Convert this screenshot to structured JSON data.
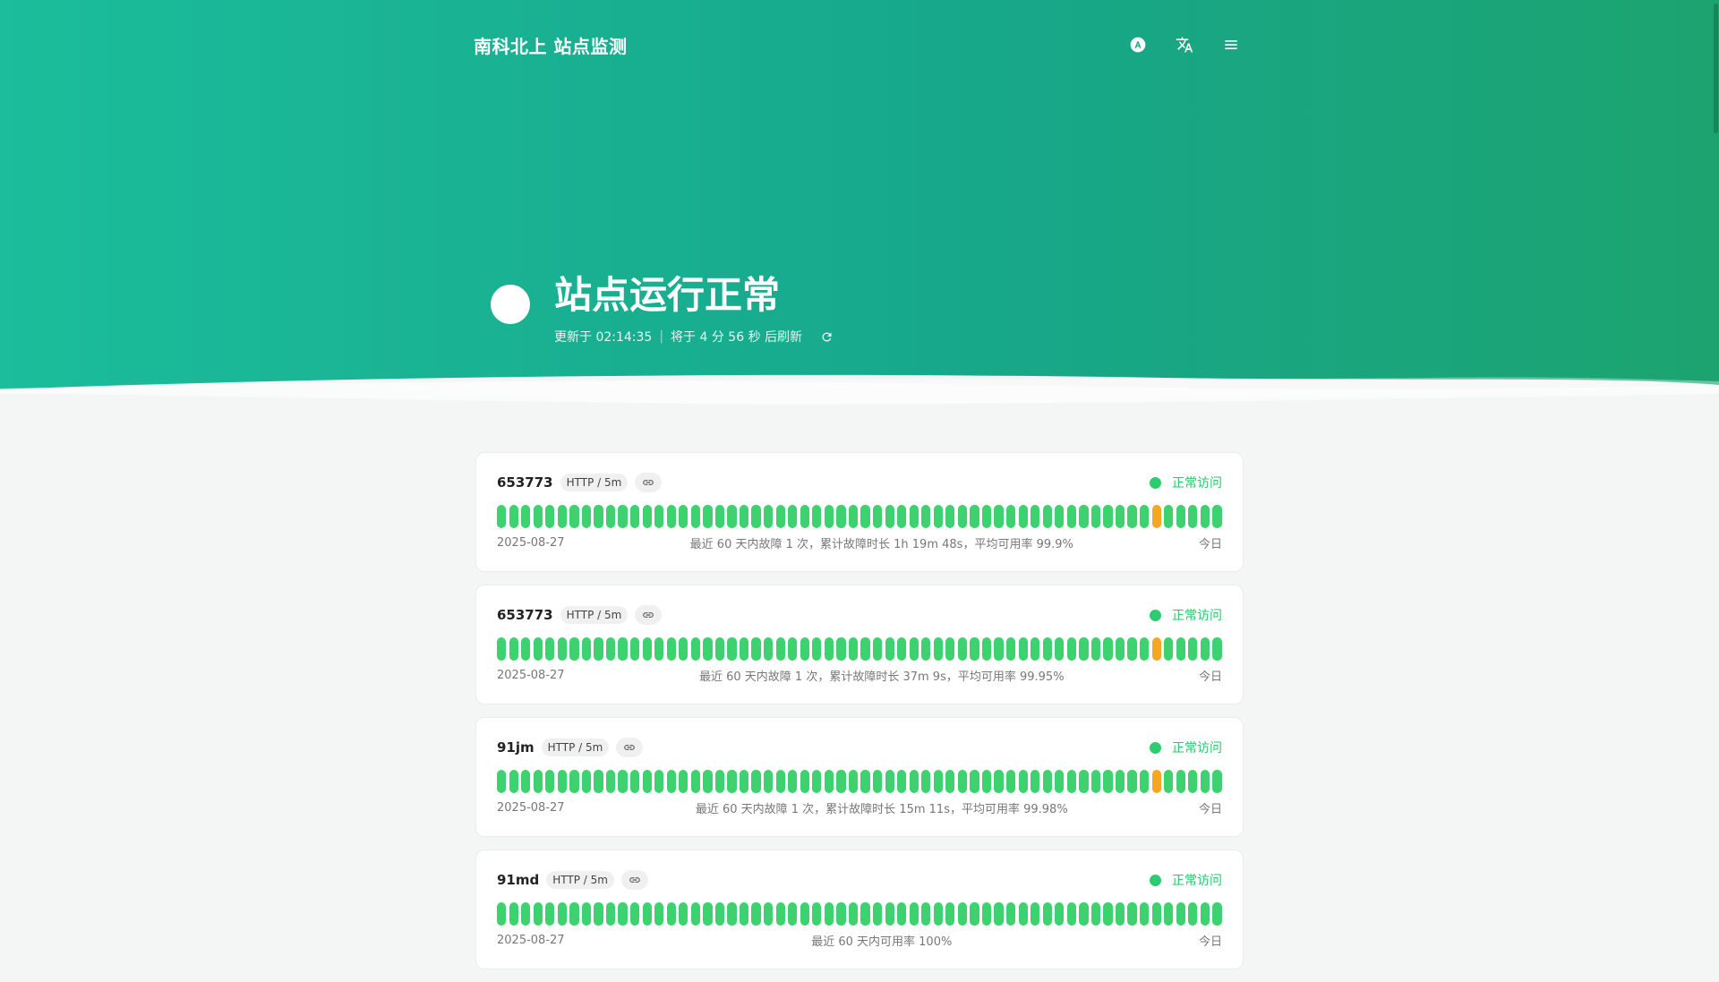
{
  "app": {
    "title": "南科北上 站点监测"
  },
  "status": {
    "headline": "站点运行正常",
    "updated": "更新于 02:14:35",
    "separator": "|",
    "next_refresh": "将于 4 分 56 秒 后刷新"
  },
  "icons": {
    "theme": "theme-toggle-icon",
    "language": "translate-icon",
    "menu": "menu-icon",
    "refresh": "refresh-icon",
    "link": "link-icon"
  },
  "colors": {
    "up": "#3dd16f",
    "incident": "#f5a623",
    "accent": "#1bbd9b"
  },
  "sites": [
    {
      "name": "653773",
      "tag": "HTTP / 5m",
      "status": "正常访问",
      "start_date": "2025-08-27",
      "summary": "最近 60 天内故障 1 次，累计故障时长 1h 19m 48s，平均可用率 99.9%",
      "end_label": "今日",
      "days": [
        "up",
        "up",
        "up",
        "up",
        "up",
        "up",
        "up",
        "up",
        "up",
        "up",
        "up",
        "up",
        "up",
        "up",
        "up",
        "up",
        "up",
        "up",
        "up",
        "up",
        "up",
        "up",
        "up",
        "up",
        "up",
        "up",
        "up",
        "up",
        "up",
        "up",
        "up",
        "up",
        "up",
        "up",
        "up",
        "up",
        "up",
        "up",
        "up",
        "up",
        "up",
        "up",
        "up",
        "up",
        "up",
        "up",
        "up",
        "up",
        "up",
        "up",
        "up",
        "up",
        "up",
        "up",
        "down",
        "up",
        "up",
        "up",
        "up",
        "up"
      ]
    },
    {
      "name": "653773",
      "tag": "HTTP / 5m",
      "status": "正常访问",
      "start_date": "2025-08-27",
      "summary": "最近 60 天内故障 1 次，累计故障时长 37m 9s，平均可用率 99.95%",
      "end_label": "今日",
      "days": [
        "up",
        "up",
        "up",
        "up",
        "up",
        "up",
        "up",
        "up",
        "up",
        "up",
        "up",
        "up",
        "up",
        "up",
        "up",
        "up",
        "up",
        "up",
        "up",
        "up",
        "up",
        "up",
        "up",
        "up",
        "up",
        "up",
        "up",
        "up",
        "up",
        "up",
        "up",
        "up",
        "up",
        "up",
        "up",
        "up",
        "up",
        "up",
        "up",
        "up",
        "up",
        "up",
        "up",
        "up",
        "up",
        "up",
        "up",
        "up",
        "up",
        "up",
        "up",
        "up",
        "up",
        "up",
        "down",
        "up",
        "up",
        "up",
        "up",
        "up"
      ]
    },
    {
      "name": "91jm",
      "tag": "HTTP / 5m",
      "status": "正常访问",
      "start_date": "2025-08-27",
      "summary": "最近 60 天内故障 1 次，累计故障时长 15m 11s，平均可用率 99.98%",
      "end_label": "今日",
      "days": [
        "up",
        "up",
        "up",
        "up",
        "up",
        "up",
        "up",
        "up",
        "up",
        "up",
        "up",
        "up",
        "up",
        "up",
        "up",
        "up",
        "up",
        "up",
        "up",
        "up",
        "up",
        "up",
        "up",
        "up",
        "up",
        "up",
        "up",
        "up",
        "up",
        "up",
        "up",
        "up",
        "up",
        "up",
        "up",
        "up",
        "up",
        "up",
        "up",
        "up",
        "up",
        "up",
        "up",
        "up",
        "up",
        "up",
        "up",
        "up",
        "up",
        "up",
        "up",
        "up",
        "up",
        "up",
        "down",
        "up",
        "up",
        "up",
        "up",
        "up"
      ]
    },
    {
      "name": "91md",
      "tag": "HTTP / 5m",
      "status": "正常访问",
      "start_date": "2025-08-27",
      "summary": "最近 60 天内可用率 100%",
      "end_label": "今日",
      "days": [
        "up",
        "up",
        "up",
        "up",
        "up",
        "up",
        "up",
        "up",
        "up",
        "up",
        "up",
        "up",
        "up",
        "up",
        "up",
        "up",
        "up",
        "up",
        "up",
        "up",
        "up",
        "up",
        "up",
        "up",
        "up",
        "up",
        "up",
        "up",
        "up",
        "up",
        "up",
        "up",
        "up",
        "up",
        "up",
        "up",
        "up",
        "up",
        "up",
        "up",
        "up",
        "up",
        "up",
        "up",
        "up",
        "up",
        "up",
        "up",
        "up",
        "up",
        "up",
        "up",
        "up",
        "up",
        "up",
        "up",
        "up",
        "up",
        "up",
        "up"
      ]
    }
  ]
}
